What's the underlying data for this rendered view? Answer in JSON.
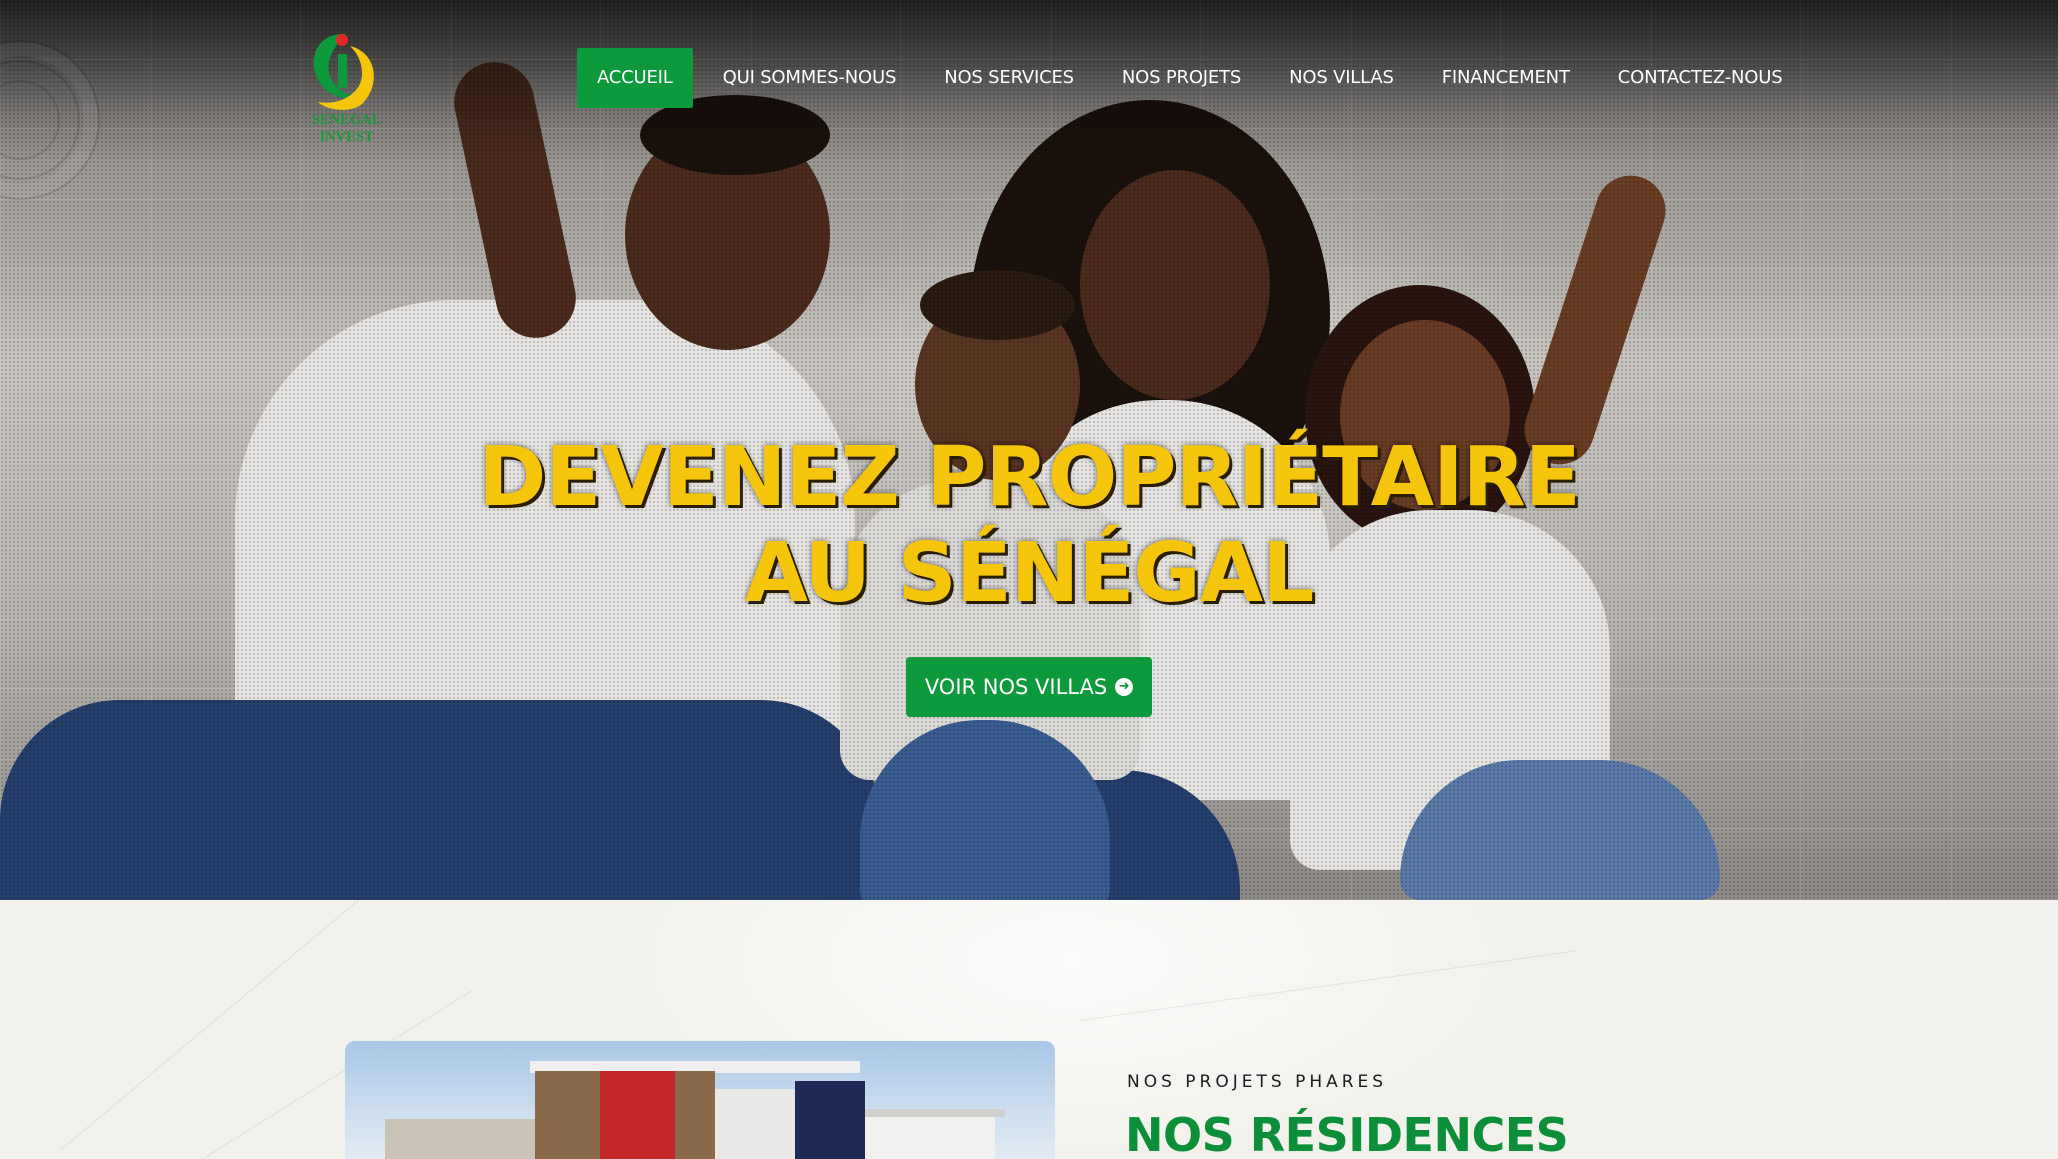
{
  "brand": {
    "name": "SENEGAL INVEST",
    "green": "#0c9a3c",
    "yellow": "#f5c50c",
    "red": "#e3262b"
  },
  "nav": {
    "items": [
      {
        "label": "ACCUEIL",
        "active": true
      },
      {
        "label": "QUI SOMMES-NOUS",
        "active": false
      },
      {
        "label": "NOS SERVICES",
        "active": false
      },
      {
        "label": "NOS PROJETS",
        "active": false
      },
      {
        "label": "NOS VILLAS",
        "active": false
      },
      {
        "label": "FINANCEMENT",
        "active": false
      },
      {
        "label": "CONTACTEZ-NOUS",
        "active": false
      }
    ]
  },
  "hero": {
    "title_line1": "DEVENEZ PROPRIÉTAIRE",
    "title_line2": "AU SÉNÉGAL",
    "cta_label": "VOIR NOS VILLAS",
    "cta_icon": "arrow-circle-right-icon"
  },
  "projects": {
    "eyebrow": "NOS PROJETS PHARES",
    "title": "NOS RÉSIDENCES"
  }
}
